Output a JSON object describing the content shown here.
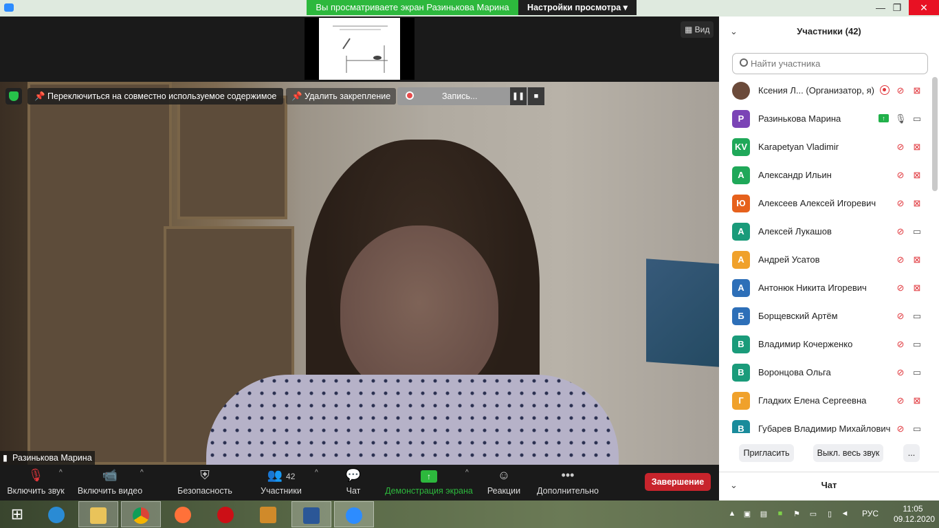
{
  "window": {
    "share_banner": "Вы просматриваете экран Разинькова Марина",
    "view_settings": "Настройки просмотра ▾",
    "controls": [
      "—",
      "❐",
      "✕"
    ]
  },
  "stage": {
    "view_button": "Вид",
    "switch_shared": "Переключиться на совместно используемое содержимое",
    "unpin": "Удалить закрепление",
    "recording_label": "Запись...",
    "speaker_name": "Разинькова Марина"
  },
  "toolbar": {
    "audio": "Включить звук",
    "video": "Включить видео",
    "security": "Безопасность",
    "participants": "Участники",
    "participants_count": "42",
    "chat": "Чат",
    "share_screen": "Демонстрация экрана",
    "reactions": "Реакции",
    "more": "Дополнительно",
    "end": "Завершение",
    "share_accent": "#2db83d",
    "end_color": "#c8242c"
  },
  "panel": {
    "title": "Участники (42)",
    "search_placeholder": "Найти участника",
    "participants": [
      {
        "name": "Ксения Л...  (Организатор, я)",
        "initials": "",
        "color": "#6b4a3a",
        "mic": "muted",
        "cam": "off",
        "recording": true
      },
      {
        "name": "Разинькова Марина",
        "initials": "Р",
        "color": "#7b44b6",
        "mic": "on",
        "cam": "on",
        "sharing": true
      },
      {
        "name": "Karapetyan Vladimir",
        "initials": "KV",
        "color": "#1fa859",
        "mic": "muted",
        "cam": "off"
      },
      {
        "name": "Александр Ильин",
        "initials": "А",
        "color": "#1fa859",
        "mic": "muted",
        "cam": "off"
      },
      {
        "name": "Алексеев Алексей Игоревич",
        "initials": "Ю",
        "color": "#e6611c",
        "mic": "muted",
        "cam": "off"
      },
      {
        "name": "Алексей Лукашов",
        "initials": "А",
        "color": "#1a9b7a",
        "mic": "muted",
        "cam": "on"
      },
      {
        "name": "Андрей Усатов",
        "initials": "А",
        "color": "#f0a12b",
        "mic": "muted",
        "cam": "off"
      },
      {
        "name": "Антонюк Никита Игоревич",
        "initials": "А",
        "color": "#2d6fb8",
        "mic": "muted",
        "cam": "off"
      },
      {
        "name": "Борщевский Артём",
        "initials": "Б",
        "color": "#2d6fb8",
        "mic": "muted",
        "cam": "on"
      },
      {
        "name": "Владимир Кочерженко",
        "initials": "В",
        "color": "#1a9b7a",
        "mic": "muted",
        "cam": "on"
      },
      {
        "name": "Воронцова Ольга",
        "initials": "В",
        "color": "#1a9b7a",
        "mic": "muted",
        "cam": "on"
      },
      {
        "name": "Гладких Елена Сергеевна",
        "initials": "Г",
        "color": "#f0a12b",
        "mic": "muted",
        "cam": "off"
      },
      {
        "name": "Губарев Владимир Михайлович",
        "initials": "В",
        "color": "#1a8b9b",
        "mic": "muted",
        "cam": "on"
      }
    ],
    "invite": "Пригласить",
    "mute_all": "Выкл. весь звук",
    "more": "...",
    "chat_title": "Чат"
  },
  "taskbar": {
    "language": "РУС",
    "time": "11:05",
    "date": "09.12.2020"
  }
}
